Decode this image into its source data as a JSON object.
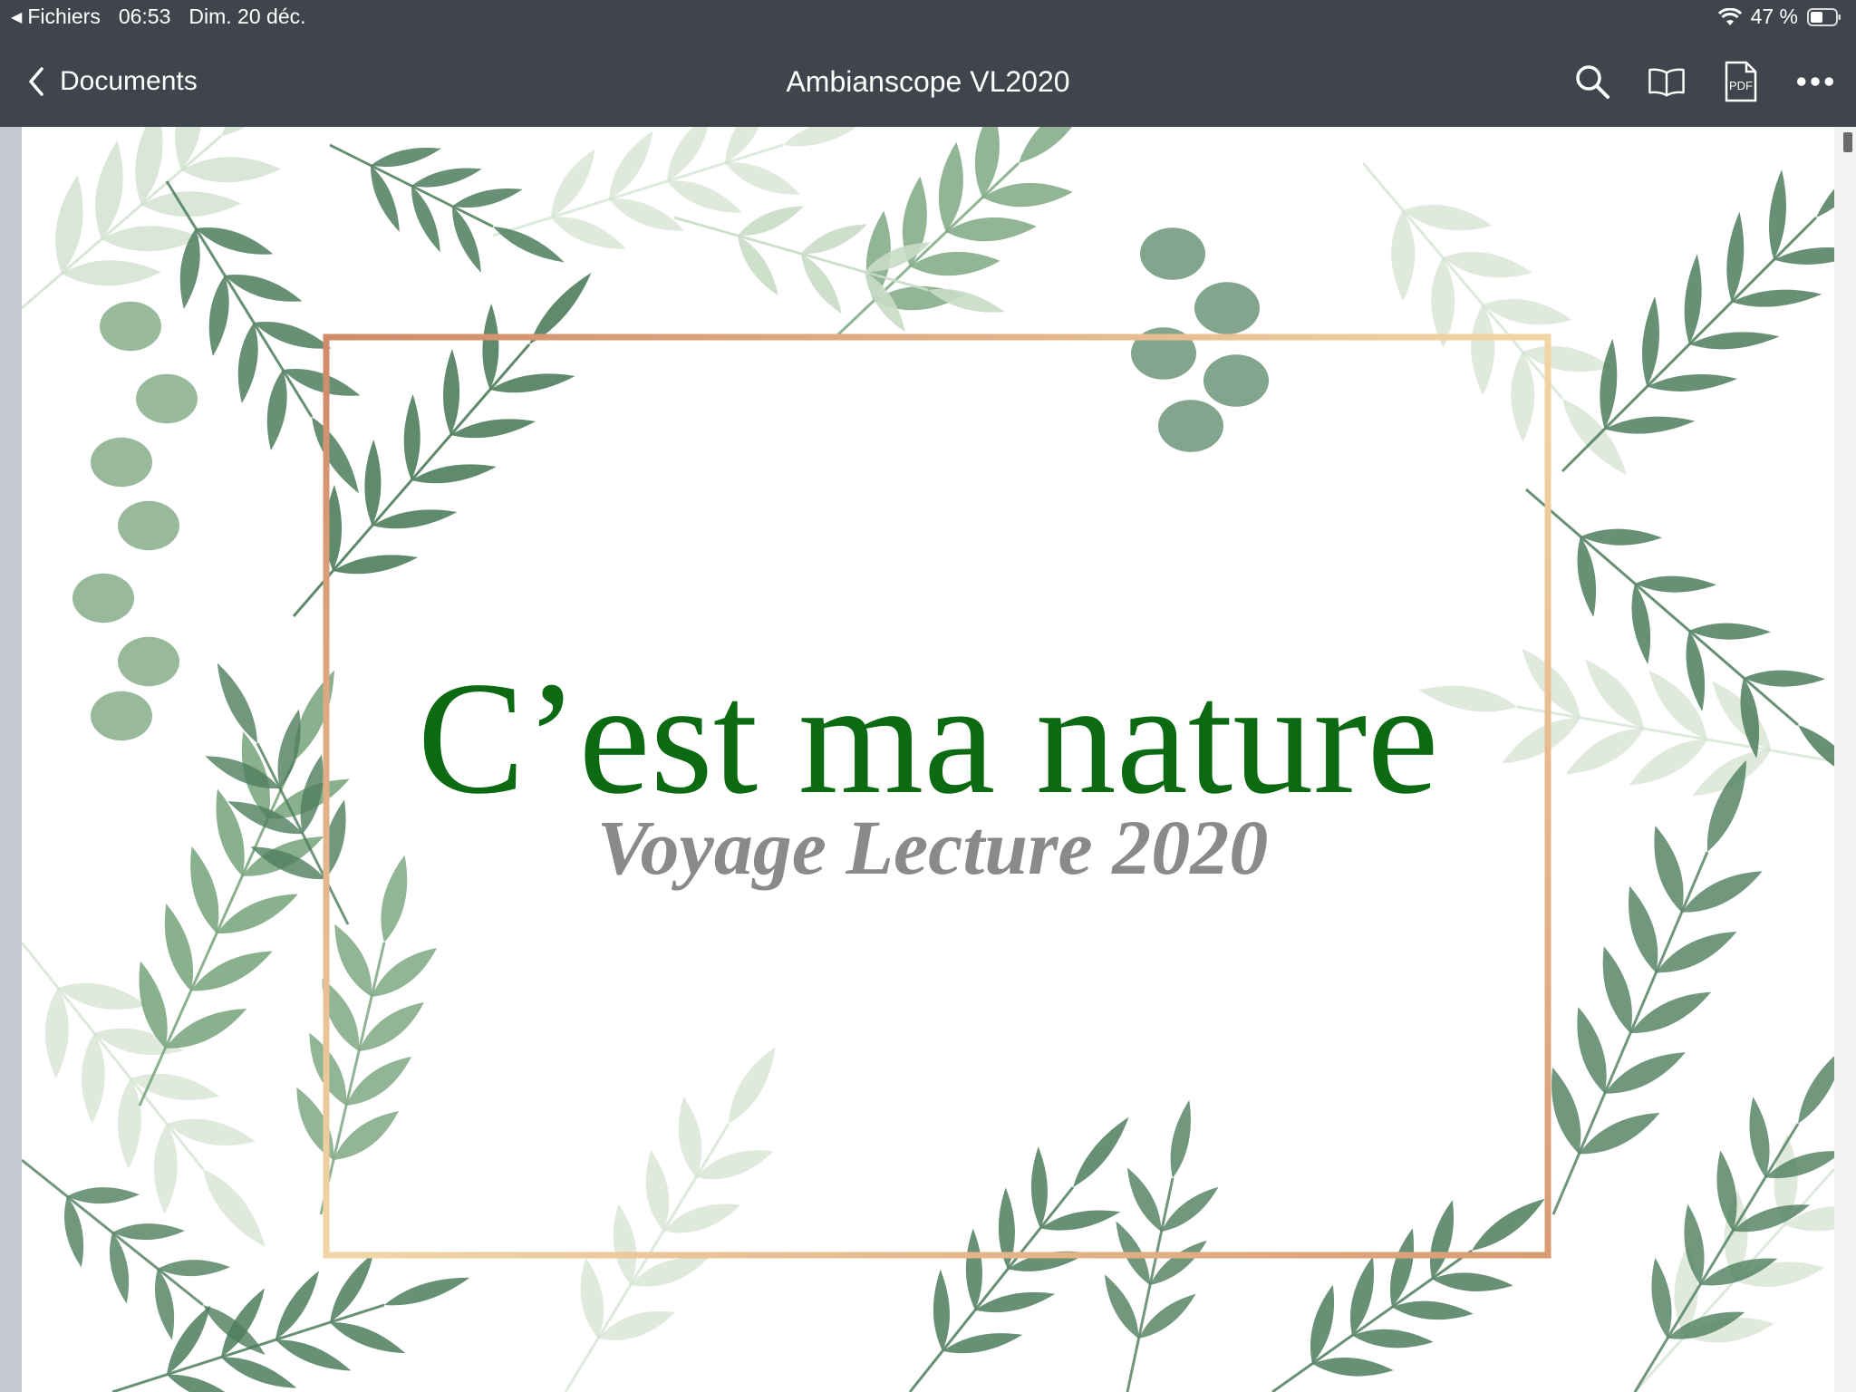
{
  "status_bar": {
    "back_app": "Fichiers",
    "time": "06:53",
    "date": "Dim. 20 déc.",
    "battery": "47 %"
  },
  "nav": {
    "back_label": "Documents",
    "title": "Ambianscope VL2020",
    "icons": [
      "search-icon",
      "book-icon",
      "pdf-icon",
      "more-icon"
    ]
  },
  "slide": {
    "title": "C’est ma nature",
    "subtitle": "Voyage Lecture 2020"
  },
  "colors": {
    "bar": "#40444c",
    "title": "#0c6b12",
    "subtitle": "#8a8a8a",
    "leaf_dark": "#4e7d5c",
    "leaf_mid": "#76a37a",
    "leaf_light": "#c9dcc7",
    "frame_copper": "#d49878",
    "frame_gold": "#f0d7ab"
  }
}
